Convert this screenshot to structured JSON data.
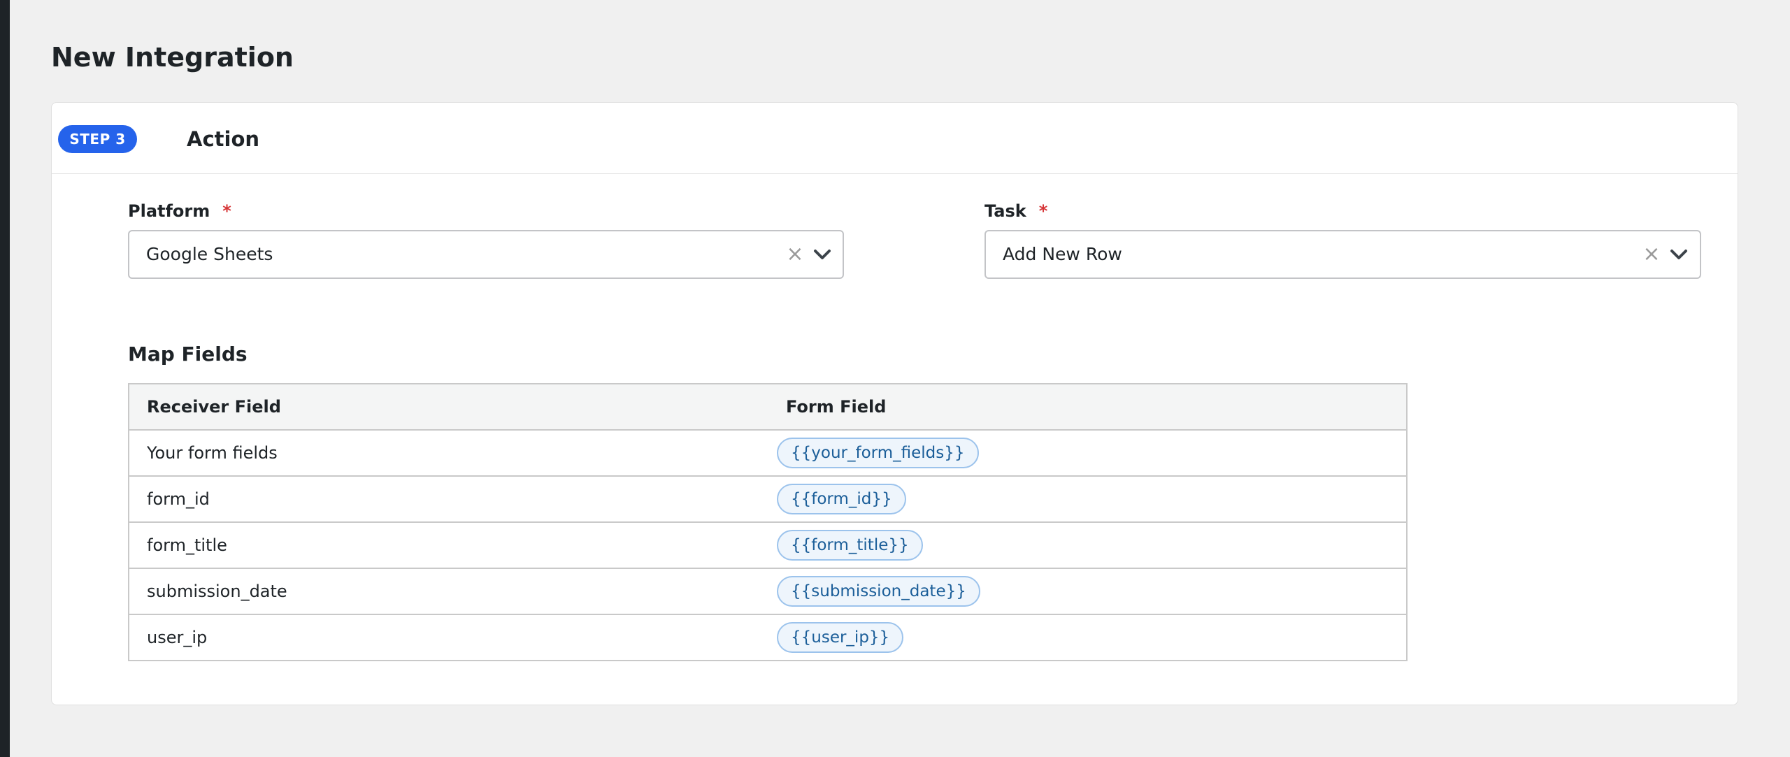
{
  "page": {
    "title": "New Integration"
  },
  "step": {
    "badge": "STEP 3",
    "title": "Action"
  },
  "platform": {
    "label": "Platform",
    "required": "*",
    "value": "Google Sheets"
  },
  "task": {
    "label": "Task",
    "required": "*",
    "value": "Add New Row"
  },
  "map_fields": {
    "title": "Map Fields",
    "headers": {
      "receiver": "Receiver Field",
      "form": "Form Field"
    },
    "rows": [
      {
        "receiver": "Your form fields",
        "form": "{{your_form_fields}}"
      },
      {
        "receiver": "form_id",
        "form": "{{form_id}}"
      },
      {
        "receiver": "form_title",
        "form": "{{form_title}}"
      },
      {
        "receiver": "submission_date",
        "form": "{{submission_date}}"
      },
      {
        "receiver": "user_ip",
        "form": "{{user_ip}}"
      }
    ]
  },
  "icons": {
    "clear": "close-icon",
    "dropdown": "chevron-down-icon"
  },
  "colors": {
    "accent": "#2563eb",
    "required": "#d63638",
    "pill_border": "#9cc3ec",
    "pill_text": "#1b5e99"
  }
}
